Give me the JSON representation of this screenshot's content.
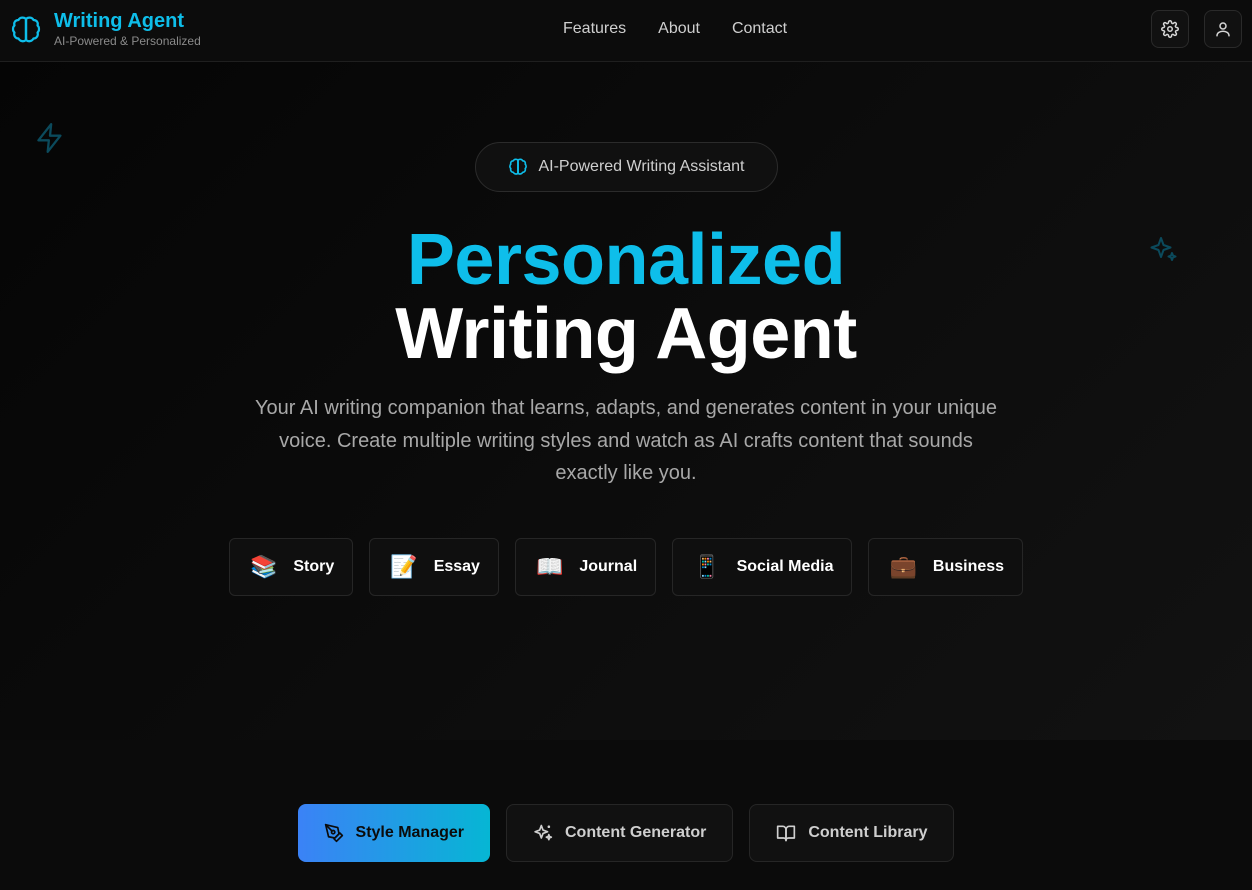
{
  "brand": {
    "title": "Writing Agent",
    "subtitle": "AI-Powered & Personalized",
    "logo_icon": "brain-icon",
    "accent": "#0ebeea"
  },
  "nav": {
    "items": [
      {
        "label": "Features"
      },
      {
        "label": "About"
      },
      {
        "label": "Contact"
      }
    ]
  },
  "header_actions": {
    "settings_icon": "gear-icon",
    "user_icon": "user-icon"
  },
  "hero": {
    "badge": "AI-Powered Writing Assistant",
    "title_line1": "Personalized",
    "title_line2": "Writing Agent",
    "description": "Your AI writing companion that learns, adapts, and generates content in your unique voice. Create multiple writing styles and watch as AI crafts content that sounds exactly like you.",
    "categories": [
      {
        "label": "Story",
        "icon": "📚"
      },
      {
        "label": "Essay",
        "icon": "📝"
      },
      {
        "label": "Journal",
        "icon": "📖"
      },
      {
        "label": "Social Media",
        "icon": "📱"
      },
      {
        "label": "Business",
        "icon": "💼"
      }
    ]
  },
  "tabs": [
    {
      "label": "Style Manager",
      "icon": "pen-tool-icon",
      "active": true
    },
    {
      "label": "Content Generator",
      "icon": "sparkles-icon",
      "active": false
    },
    {
      "label": "Content Library",
      "icon": "book-open-icon",
      "active": false
    }
  ],
  "colors": {
    "background": "#0b0b0b",
    "accent": "#0ebeea",
    "tab_gradient_start": "#3b82f6",
    "tab_gradient_end": "#06b6d4"
  }
}
